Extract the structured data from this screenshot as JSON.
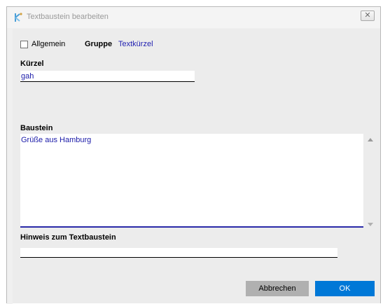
{
  "window": {
    "title": "Textbaustein bearbeiten",
    "close_symbol": "✕"
  },
  "form": {
    "allgemein_label": "Allgemein",
    "allgemein_checked": false,
    "gruppe_label": "Gruppe",
    "gruppe_value": "Textkürzel",
    "kuerzel_label": "Kürzel",
    "kuerzel_value": "gah",
    "baustein_label": "Baustein",
    "baustein_value": "Grüße aus Hamburg",
    "hinweis_label": "Hinweis zum Textbaustein",
    "hinweis_value": ""
  },
  "buttons": {
    "cancel_label": "Abbrechen",
    "ok_label": "OK"
  },
  "colors": {
    "accent": "#0078d7",
    "value_text": "#1a1aa8"
  }
}
